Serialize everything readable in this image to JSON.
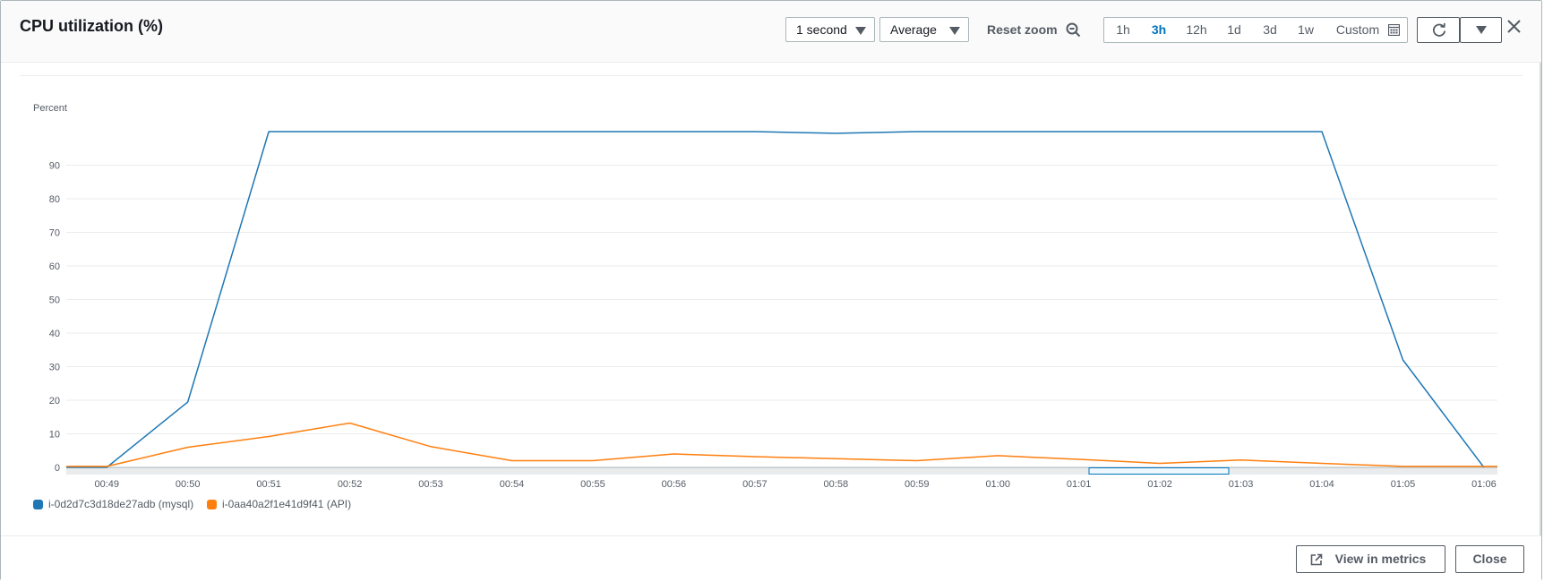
{
  "header": {
    "title": "CPU utilization (%)",
    "period_select": "1 second",
    "stat_select": "Average",
    "reset_zoom": "Reset zoom",
    "ranges": [
      {
        "label": "1h",
        "active": false
      },
      {
        "label": "3h",
        "active": true
      },
      {
        "label": "12h",
        "active": false
      },
      {
        "label": "1d",
        "active": false
      },
      {
        "label": "3d",
        "active": false
      },
      {
        "label": "1w",
        "active": false
      },
      {
        "label": "Custom",
        "active": false
      }
    ],
    "icons": [
      "zoom-out-icon",
      "calendar-icon",
      "refresh-icon",
      "caret-down-icon",
      "close-icon"
    ]
  },
  "chart_data": {
    "type": "line",
    "ylabel": "Percent",
    "ylim": [
      0,
      100
    ],
    "yticks": [
      0,
      10,
      20,
      30,
      40,
      50,
      60,
      70,
      80,
      90
    ],
    "x": [
      "00:48:30",
      "00:49",
      "00:50",
      "00:51",
      "00:52",
      "00:53",
      "00:54",
      "00:55",
      "00:56",
      "00:57",
      "00:58",
      "00:59",
      "01:00",
      "01:01",
      "01:02",
      "01:03",
      "01:04",
      "01:05",
      "01:06",
      "01:06:10"
    ],
    "xticks": [
      "00:49",
      "00:50",
      "00:51",
      "00:52",
      "00:53",
      "00:54",
      "00:55",
      "00:56",
      "00:57",
      "00:58",
      "00:59",
      "01:00",
      "01:01",
      "01:02",
      "01:03",
      "01:04",
      "01:05",
      "01:06"
    ],
    "grid": true,
    "legend_position": "bottom-left",
    "series": [
      {
        "name": "i-0d2d7c3d18de27adb (mysql)",
        "color": "#1f77b4",
        "values": [
          0,
          0,
          19.5,
          100,
          100,
          100,
          100,
          100,
          100,
          100,
          99.5,
          100,
          100,
          100,
          100,
          100,
          100,
          32,
          0,
          null
        ]
      },
      {
        "name": "i-0aa40a2f1e41d9f41 (API)",
        "color": "#ff7f0e",
        "values": [
          0.3,
          0.3,
          6,
          9.2,
          13.2,
          6.2,
          2,
          2,
          4,
          3.2,
          2.6,
          2,
          3.5,
          2.4,
          1.2,
          2.2,
          1.2,
          0.3,
          0.3,
          0.3
        ]
      }
    ]
  },
  "footer": {
    "view_in_metrics": "View in metrics",
    "close": "Close",
    "icons": [
      "external-link-icon"
    ]
  }
}
